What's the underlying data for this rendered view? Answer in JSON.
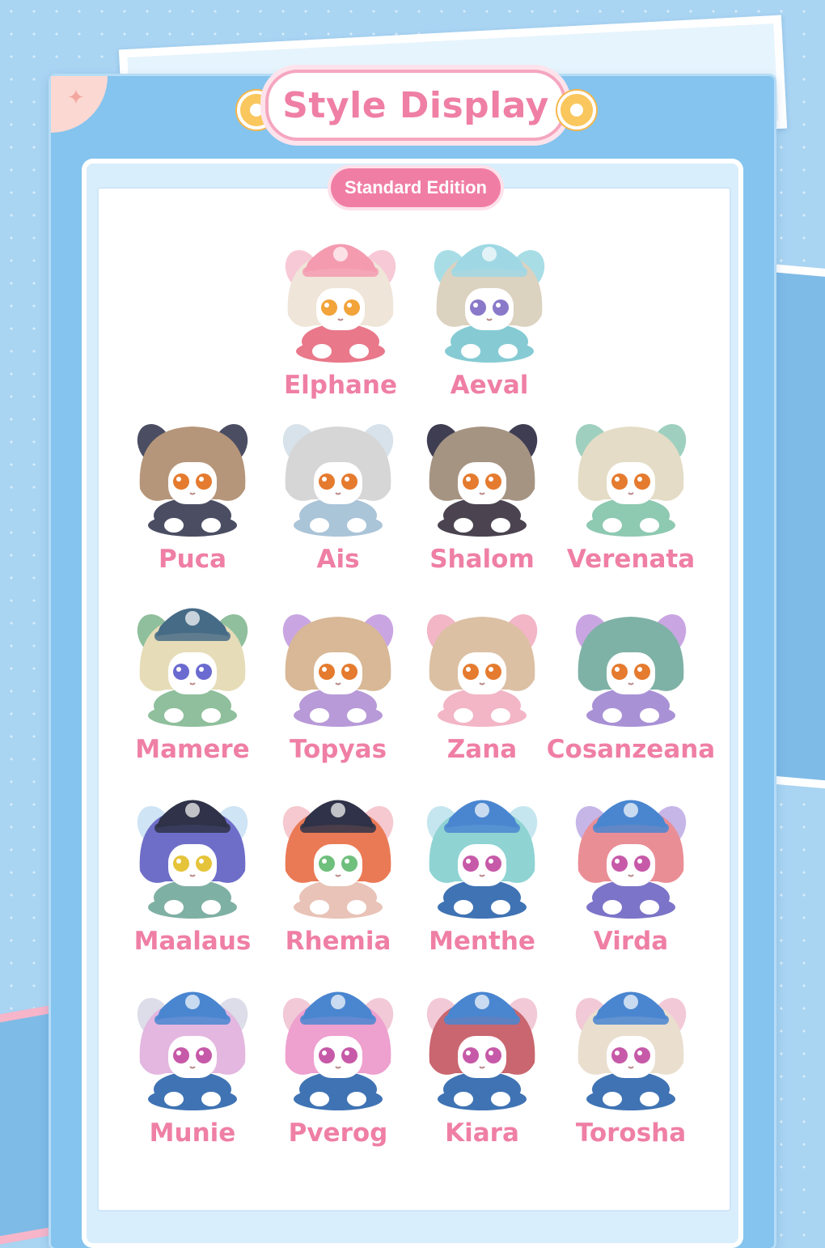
{
  "title": "Style Display",
  "edition": "Standard Edition",
  "figures": [
    {
      "name": "Elphane",
      "hair": "#efe5d8",
      "ears": "#f7c9d6",
      "eyes": "#f2a33a",
      "body": "#e9788a",
      "hat": "#f49bb0"
    },
    {
      "name": "Aeval",
      "hair": "#dcd2c0",
      "ears": "#a8dde6",
      "eyes": "#8a79c9",
      "body": "#86cbd4",
      "hat": "#9fd8e4"
    },
    {
      "name": "Puca",
      "hair": "#b6967a",
      "ears": "#4b4e63",
      "eyes": "#e57b2f",
      "body": "#4b4e63",
      "hat": ""
    },
    {
      "name": "Ais",
      "hair": "#d7d6d6",
      "ears": "#d7e2ea",
      "eyes": "#e57b2f",
      "body": "#aac4d8",
      "hat": ""
    },
    {
      "name": "Shalom",
      "hair": "#a69483",
      "ears": "#3f3d52",
      "eyes": "#e57b2f",
      "body": "#4b4450",
      "hat": ""
    },
    {
      "name": "Verenata",
      "hair": "#e4dcc6",
      "ears": "#9fd0bf",
      "eyes": "#e57b2f",
      "body": "#8ec9b2",
      "hat": ""
    },
    {
      "name": "Mamere",
      "hair": "#e6dcb8",
      "ears": "#8fbf9c",
      "eyes": "#6a6ad0",
      "body": "#8fbf9c",
      "hat": "#466b86"
    },
    {
      "name": "Topyas",
      "hair": "#d8b896",
      "ears": "#c9a6e2",
      "eyes": "#e57b2f",
      "body": "#b89ad8",
      "hat": ""
    },
    {
      "name": "Zana",
      "hair": "#dcc0a4",
      "ears": "#f2b6c6",
      "eyes": "#e57b2f",
      "body": "#f2b6c6",
      "hat": ""
    },
    {
      "name": "Cosanzeana",
      "hair": "#7fb2a6",
      "ears": "#c9a6e2",
      "eyes": "#e57b2f",
      "body": "#a991d6",
      "hat": ""
    },
    {
      "name": "Maalaus",
      "hair": "#6e6ec9",
      "ears": "#cfe4f4",
      "eyes": "#e6c43a",
      "body": "#7fb0a4",
      "hat": "#2f3248"
    },
    {
      "name": "Rhemia",
      "hair": "#ea7a56",
      "ears": "#f5c9cf",
      "eyes": "#6fbf7d",
      "body": "#e9c3b7",
      "hat": "#2f3248"
    },
    {
      "name": "Menthe",
      "hair": "#8fd3d3",
      "ears": "#c6e6ef",
      "eyes": "#c75aa8",
      "body": "#3f73b4",
      "hat": "#4a86d0"
    },
    {
      "name": "Virda",
      "hair": "#ea8e96",
      "ears": "#c6b6e8",
      "eyes": "#c75aa8",
      "body": "#7c74c8",
      "hat": "#4a86d0"
    },
    {
      "name": "Munie",
      "hair": "#e3b7e0",
      "ears": "#dcdde8",
      "eyes": "#c75aa8",
      "body": "#3f73b4",
      "hat": "#4a86d0"
    },
    {
      "name": "Pverog",
      "hair": "#eea0cf",
      "ears": "#f2c9d6",
      "eyes": "#c75aa8",
      "body": "#3f73b4",
      "hat": "#4a86d0"
    },
    {
      "name": "Kiara",
      "hair": "#c9666f",
      "ears": "#f2c9d6",
      "eyes": "#c75aa8",
      "body": "#3f73b4",
      "hat": "#4a86d0"
    },
    {
      "name": "Torosha",
      "hair": "#eadfcf",
      "ears": "#f2c9d6",
      "eyes": "#c75aa8",
      "body": "#3f73b4",
      "hat": "#4a86d0"
    }
  ]
}
